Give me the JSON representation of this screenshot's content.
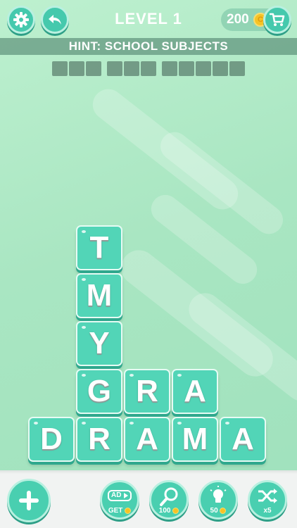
{
  "header": {
    "level_label": "LEVEL 1",
    "coin_count": "200",
    "coin_symbol": "C"
  },
  "hint": {
    "text": "HINT: SCHOOL SUBJECTS"
  },
  "answer_slots": [
    3,
    3,
    5
  ],
  "board": {
    "tiles": [
      {
        "letter": "T",
        "col": 1,
        "row": 0
      },
      {
        "letter": "M",
        "col": 1,
        "row": 1
      },
      {
        "letter": "Y",
        "col": 1,
        "row": 2
      },
      {
        "letter": "G",
        "col": 1,
        "row": 3
      },
      {
        "letter": "R",
        "col": 2,
        "row": 3
      },
      {
        "letter": "A",
        "col": 3,
        "row": 3
      },
      {
        "letter": "D",
        "col": 0,
        "row": 4
      },
      {
        "letter": "R",
        "col": 1,
        "row": 4
      },
      {
        "letter": "A",
        "col": 2,
        "row": 4
      },
      {
        "letter": "M",
        "col": 3,
        "row": 4
      },
      {
        "letter": "A",
        "col": 4,
        "row": 4
      }
    ]
  },
  "powerups": {
    "ad": {
      "badge": "AD",
      "caption": "GET"
    },
    "magnifier": {
      "cost": "100"
    },
    "hint_bulb": {
      "cost": "50"
    },
    "shuffle": {
      "caption": "x5"
    }
  },
  "colors": {
    "accent": "#49cfb0",
    "tile": "#52d5b7",
    "background": "#a9e6c2",
    "coin": "#f6c325"
  }
}
